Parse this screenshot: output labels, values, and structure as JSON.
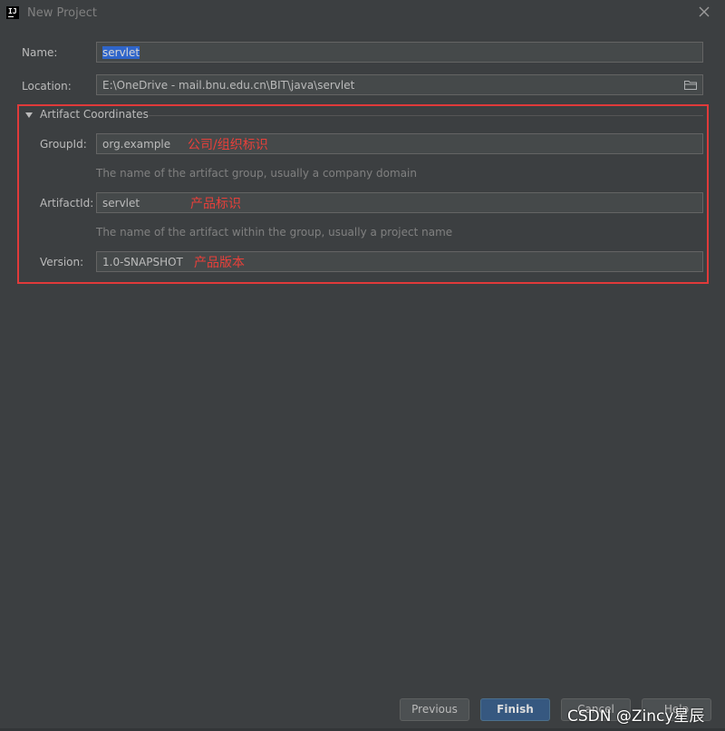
{
  "window": {
    "title": "New Project"
  },
  "form": {
    "name_label": "Name:",
    "name_value": "servlet",
    "location_label": "Location:",
    "location_value": "E:\\OneDrive - mail.bnu.edu.cn\\BIT\\java\\servlet"
  },
  "artifact": {
    "section_title": "Artifact Coordinates",
    "group_label": "GroupId:",
    "group_value": "org.example",
    "group_hint": "The name of the artifact group, usually a company domain",
    "artifact_label": "ArtifactId:",
    "artifact_value": "servlet",
    "artifact_hint": "The name of the artifact within the group, usually a project name",
    "version_label": "Version:",
    "version_value": "1.0-SNAPSHOT"
  },
  "annotations": {
    "group_note": "公司/组织标识",
    "artifact_note": "产品标识",
    "version_note": "产品版本"
  },
  "buttons": {
    "previous": "Previous",
    "finish": "Finish",
    "cancel": "Cancel",
    "help": "Help"
  },
  "watermark": "CSDN @Zincy星辰",
  "colors": {
    "background": "#3c3f41",
    "field": "#45494a",
    "accent": "#365880",
    "selection": "#2f65ca",
    "annotation": "#e8403a"
  }
}
